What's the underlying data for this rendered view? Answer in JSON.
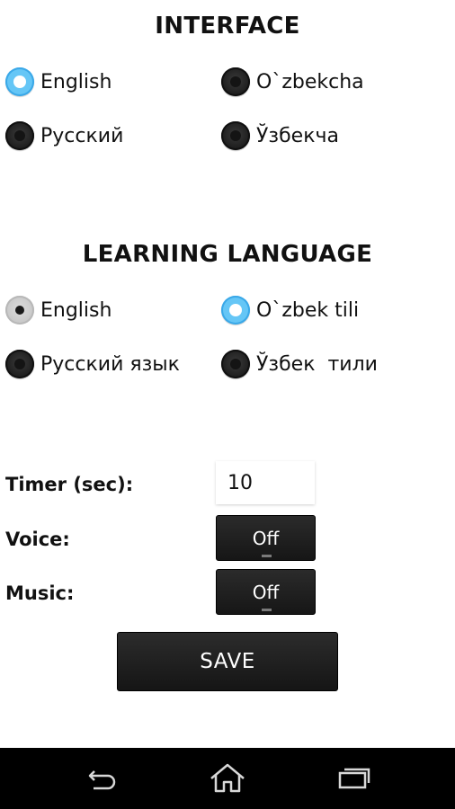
{
  "interface": {
    "title": "INTERFACE",
    "options": [
      {
        "label": "English",
        "state": "on"
      },
      {
        "label": "O`zbekcha",
        "state": "off"
      },
      {
        "label": "Русский",
        "state": "off"
      },
      {
        "label": "Ўзбекча",
        "state": "off"
      }
    ]
  },
  "learning": {
    "title": "LEARNING LANGUAGE",
    "options": [
      {
        "label": "English",
        "state": "disabled"
      },
      {
        "label": "O`zbek tili",
        "state": "on"
      },
      {
        "label": "Русский язык",
        "state": "off"
      },
      {
        "label": "Ўзбек  тили",
        "state": "off"
      }
    ]
  },
  "settings": {
    "timer_label": "Timer (sec):",
    "timer_value": "10",
    "voice_label": "Voice:",
    "voice_value": "Off",
    "music_label": "Music:",
    "music_value": "Off",
    "save_label": "SAVE"
  },
  "navbar": {
    "icons": [
      "back-icon",
      "home-icon",
      "recent-apps-icon"
    ]
  },
  "colors": {
    "accent": "#65c6f6",
    "button_bg": "#1e1e1e",
    "navbar_bg": "#000000"
  }
}
